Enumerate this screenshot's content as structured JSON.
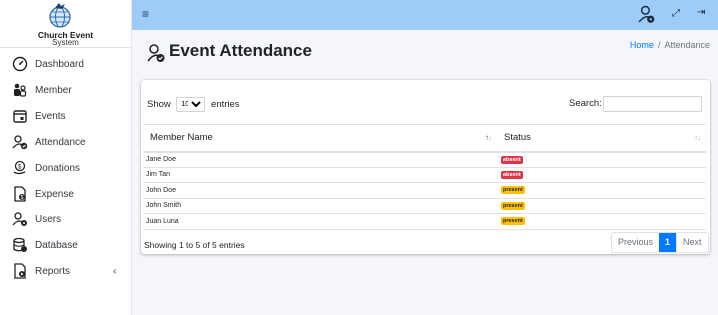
{
  "brand": {
    "name": "Church Event",
    "subtitle": "System"
  },
  "sidebar": {
    "items": [
      {
        "label": "Dashboard",
        "icon": "gauge-icon"
      },
      {
        "label": "Member",
        "icon": "members-icon"
      },
      {
        "label": "Events",
        "icon": "calendar-icon"
      },
      {
        "label": "Attendance",
        "icon": "user-check-icon"
      },
      {
        "label": "Donations",
        "icon": "donation-icon"
      },
      {
        "label": "Expense",
        "icon": "expense-file-icon"
      },
      {
        "label": "Users",
        "icon": "user-gear-icon"
      },
      {
        "label": "Database",
        "icon": "database-icon"
      },
      {
        "label": "Reports",
        "icon": "report-file-icon",
        "caret": "‹"
      }
    ]
  },
  "topbar": {
    "menu_icon": "≡",
    "expand_icon": "⤢",
    "logout_icon": "⇥"
  },
  "header": {
    "title": "Event Attendance",
    "breadcrumb_home": "Home",
    "breadcrumb_sep": "/",
    "breadcrumb_current": "Attendance"
  },
  "table_controls": {
    "show_label": "Show",
    "entries_value": "10",
    "entries_label": "entries",
    "search_label": "Search:"
  },
  "table": {
    "columns": [
      "Member Name",
      "Status"
    ],
    "rows": [
      {
        "name": "Jane Doe",
        "status": "absent"
      },
      {
        "name": "Jim Tan",
        "status": "absent"
      },
      {
        "name": "John Doe",
        "status": "present"
      },
      {
        "name": "John Smith",
        "status": "present"
      },
      {
        "name": "Juan Luna",
        "status": "present"
      }
    ]
  },
  "footer": {
    "info": "Showing 1 to 5 of 5 entries",
    "prev": "Previous",
    "page": "1",
    "next": "Next"
  },
  "colors": {
    "topbar": "#9ecbf8",
    "primary": "#007bff",
    "absent": "#dc3545",
    "present": "#ffc107"
  }
}
